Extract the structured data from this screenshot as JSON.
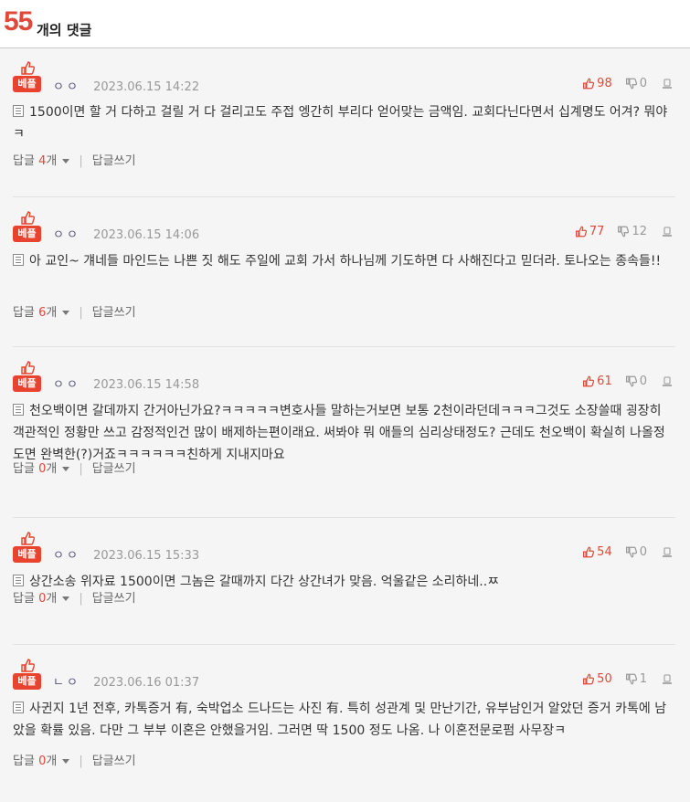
{
  "header": {
    "count": "55",
    "label": "개의 댓글"
  },
  "best_label": "베플",
  "reply_label": "답글",
  "reply_unit": "개",
  "write_reply_label": "답글쓰기",
  "colors": {
    "accent": "#e0483a",
    "background": "#f5f5f5"
  },
  "comments": [
    {
      "author": "ㅇㅇ",
      "date": "2023.06.15 14:22",
      "likes": "98",
      "dislikes": "0",
      "text": "1500이면 할 거 다하고 걸릴 거 다 걸리고도 주접 엥간히 부리다 얻어맞는 금액임. 교회다닌다면서 십계명도 어겨? 뭐야ㅋ",
      "replies": "4"
    },
    {
      "author": "ㅇㅇ",
      "date": "2023.06.15 14:06",
      "likes": "77",
      "dislikes": "12",
      "text": "아 교인~ 걔네들 마인드는 나쁜 짓 해도 주일에 교회 가서 하나님께 기도하면 다 사해진다고 믿더라. 토나오는 종속들!!",
      "replies": "6"
    },
    {
      "author": "ㅇㅇ",
      "date": "2023.06.15 14:58",
      "likes": "61",
      "dislikes": "0",
      "text": "천오백이면 갈데까지 간거아닌가요?ㅋㅋㅋㅋㅋ변호사들 말하는거보면 보통 2천이라던데ㅋㅋㅋ그것도 소장쓸때 굉장히 객관적인 정황만 쓰고 감정적인건 많이 배제하는편이래요. 써봐야 뭐 애들의 심리상태정도? 근데도 천오백이 확실히 나올정도면 완벽한(?)거죠ㅋㅋㅋㅋㅋㅋ친하게 지내지마요",
      "replies": "0"
    },
    {
      "author": "ㅇㅇ",
      "date": "2023.06.15 15:33",
      "likes": "54",
      "dislikes": "0",
      "text": "상간소송 위자료 1500이면 그놈은 갈때까지 다간 상간녀가 맞음. 억울같은 소리하네..ㅉ",
      "replies": "0"
    },
    {
      "author": "ㄴㅇ",
      "date": "2023.06.16 01:37",
      "likes": "50",
      "dislikes": "1",
      "text": "사귄지 1년 전후, 카톡증거 有, 숙박업소 드나드는 사진 有. 특히 성관계 및 만난기간, 유부남인거 알았던 증거 카톡에 남았을 확률 있음. 다만 그 부부 이혼은 안했을거임. 그러면 딱 1500 정도 나옴. 나 이혼전문로펌 사무장ㅋ",
      "replies": "0"
    }
  ]
}
